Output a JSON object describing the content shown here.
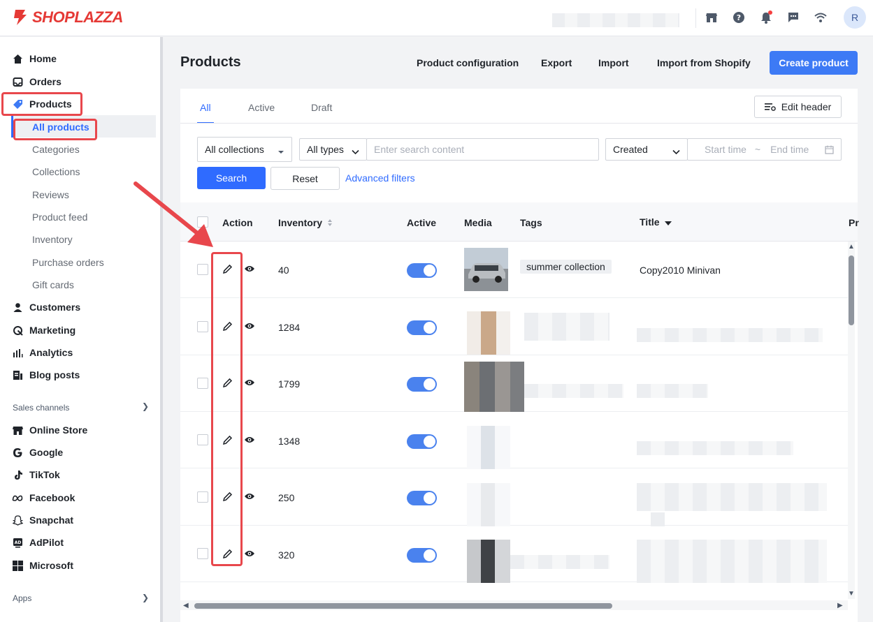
{
  "brand": {
    "name": "SHOPLAZZA",
    "color": "#e53935"
  },
  "topbar": {
    "icons": [
      "store-icon",
      "help-icon",
      "bell-icon",
      "chat-icon",
      "wifi-icon"
    ],
    "avatar_initial": "R"
  },
  "sidebar": {
    "items": [
      {
        "label": "Home",
        "icon": "home-icon"
      },
      {
        "label": "Orders",
        "icon": "inbox-icon"
      },
      {
        "label": "Products",
        "icon": "tag-icon"
      }
    ],
    "product_subitems": [
      "All products",
      "Categories",
      "Collections",
      "Reviews",
      "Product feed",
      "Inventory",
      "Purchase orders",
      "Gift cards"
    ],
    "items_after": [
      {
        "label": "Customers",
        "icon": "person-icon"
      },
      {
        "label": "Marketing",
        "icon": "marketing-icon"
      },
      {
        "label": "Analytics",
        "icon": "bar-chart-icon"
      },
      {
        "label": "Blog posts",
        "icon": "blog-icon"
      }
    ],
    "sales_channels_label": "Sales channels",
    "channels": [
      {
        "label": "Online Store",
        "icon": "store-icon"
      },
      {
        "label": "Google",
        "icon": "google-icon"
      },
      {
        "label": "TikTok",
        "icon": "tiktok-icon"
      },
      {
        "label": "Facebook",
        "icon": "meta-icon"
      },
      {
        "label": "Snapchat",
        "icon": "snapchat-icon"
      },
      {
        "label": "AdPilot",
        "icon": "adpilot-icon"
      },
      {
        "label": "Microsoft",
        "icon": "microsoft-icon"
      }
    ],
    "apps_label": "Apps"
  },
  "header": {
    "title": "Products",
    "links": [
      "Product configuration",
      "Export",
      "Import",
      "Import from Shopify"
    ],
    "primary_button": "Create product"
  },
  "tabs": [
    "All",
    "Active",
    "Draft"
  ],
  "edit_header_label": "Edit header",
  "filters": {
    "collections": "All collections",
    "types": "All types",
    "search_placeholder": "Enter search content",
    "sort": "Created",
    "start_placeholder": "Start time",
    "range_sep": "~",
    "end_placeholder": "End time",
    "search_button": "Search",
    "reset_button": "Reset",
    "advanced": "Advanced filters"
  },
  "table": {
    "columns": [
      "Action",
      "Inventory",
      "Active",
      "Media",
      "Tags",
      "Title",
      "Pr"
    ],
    "rows": [
      {
        "inventory": "40",
        "active": true,
        "tag": "summer collection",
        "title": "Copy2010 Minivan"
      },
      {
        "inventory": "1284",
        "active": true
      },
      {
        "inventory": "1799",
        "active": true
      },
      {
        "inventory": "1348",
        "active": true
      },
      {
        "inventory": "250",
        "active": true
      },
      {
        "inventory": "320",
        "active": true
      }
    ]
  },
  "colors": {
    "accent": "#2f6bff",
    "annotation": "#e8474c"
  }
}
